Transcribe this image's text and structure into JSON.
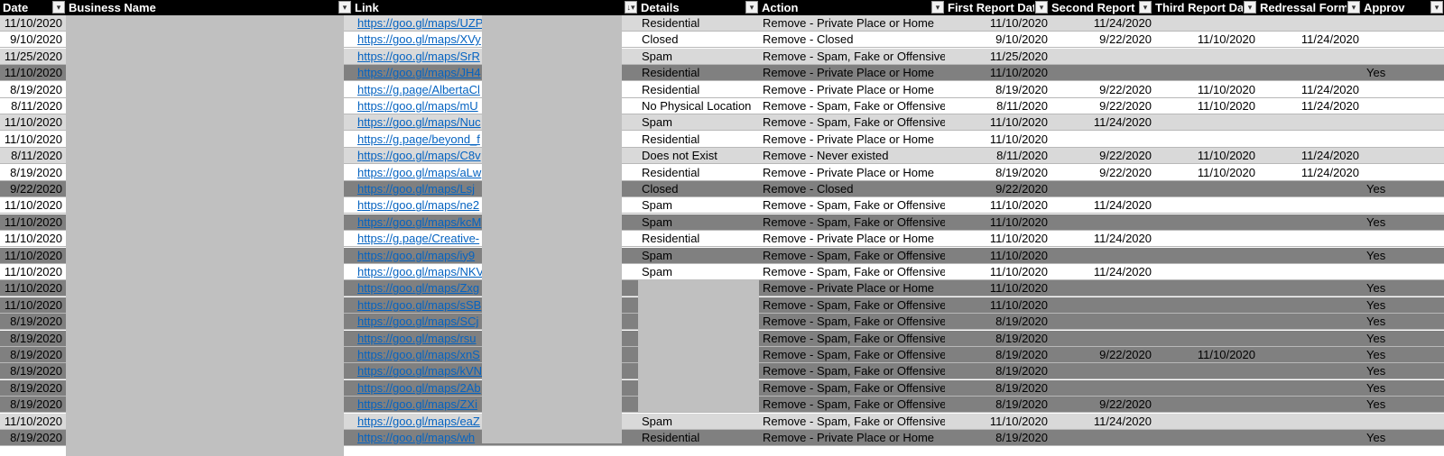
{
  "header": {
    "columns": [
      {
        "label": "Date",
        "filter": "▾"
      },
      {
        "label": "Business Name",
        "filter": "▾"
      },
      {
        "label": "Link",
        "filter": "↓▾"
      },
      {
        "label": "Details",
        "filter": "▾"
      },
      {
        "label": "Action",
        "filter": "▾"
      },
      {
        "label": "First Report Date",
        "filter": "▾"
      },
      {
        "label": "Second Report Da",
        "filter": "▾"
      },
      {
        "label": "Third Report Date",
        "filter": "▾"
      },
      {
        "label": "Redressal Form",
        "filter": "▾"
      },
      {
        "label": "Approv",
        "filter": "▾"
      }
    ]
  },
  "rows": [
    {
      "date": "11/10/2020",
      "link": "https://goo.gl/maps/UZP",
      "details": "Residential",
      "action": "Remove - Private Place or Home",
      "first": "11/10/2020",
      "second": "11/24/2020",
      "third": "",
      "form": "",
      "approved": "",
      "shade": "light"
    },
    {
      "date": "9/10/2020",
      "link": "https://goo.gl/maps/XVy",
      "details": "Closed",
      "action": "Remove - Closed",
      "first": "9/10/2020",
      "second": "9/22/2020",
      "third": "11/10/2020",
      "form": "11/24/2020",
      "approved": "",
      "shade": "white"
    },
    {
      "date": "11/25/2020",
      "link": "https://goo.gl/maps/SrR",
      "details": "Spam",
      "action": "Remove - Spam, Fake or Offensive",
      "first": "11/25/2020",
      "second": "",
      "third": "",
      "form": "",
      "approved": "",
      "shade": "light"
    },
    {
      "date": "11/10/2020",
      "link": "https://goo.gl/maps/JH4",
      "details": "Residential",
      "action": "Remove - Private Place or Home",
      "first": "11/10/2020",
      "second": "",
      "third": "",
      "form": "",
      "approved": "Yes",
      "shade": "dark"
    },
    {
      "date": "8/19/2020",
      "link": "https://g.page/AlbertaCl",
      "details": "Residential",
      "action": "Remove - Private Place or Home",
      "first": "8/19/2020",
      "second": "9/22/2020",
      "third": "11/10/2020",
      "form": "11/24/2020",
      "approved": "",
      "shade": "white"
    },
    {
      "date": "8/11/2020",
      "link": "https://goo.gl/maps/mU",
      "details": "No Physical Location",
      "action": "Remove - Spam, Fake or Offensive",
      "first": "8/11/2020",
      "second": "9/22/2020",
      "third": "11/10/2020",
      "form": "11/24/2020",
      "approved": "",
      "shade": "white"
    },
    {
      "date": "11/10/2020",
      "link": "https://goo.gl/maps/Nuc",
      "details": "Spam",
      "action": "Remove - Spam, Fake or Offensive",
      "first": "11/10/2020",
      "second": "11/24/2020",
      "third": "",
      "form": "",
      "approved": "",
      "shade": "light"
    },
    {
      "date": "11/10/2020",
      "link": "https://g.page/beyond_f",
      "details": "Residential",
      "action": "Remove - Private Place or Home",
      "first": "11/10/2020",
      "second": "",
      "third": "",
      "form": "",
      "approved": "",
      "shade": "white"
    },
    {
      "date": "8/11/2020",
      "link": "https://goo.gl/maps/C8v",
      "details": "Does not Exist",
      "action": "Remove - Never existed",
      "first": "8/11/2020",
      "second": "9/22/2020",
      "third": "11/10/2020",
      "form": "11/24/2020",
      "approved": "",
      "shade": "light"
    },
    {
      "date": "8/19/2020",
      "link": "https://goo.gl/maps/aLw",
      "details": "Residential",
      "action": "Remove - Private Place or Home",
      "first": "8/19/2020",
      "second": "9/22/2020",
      "third": "11/10/2020",
      "form": "11/24/2020",
      "approved": "",
      "shade": "white"
    },
    {
      "date": "9/22/2020",
      "link": "https://goo.gl/maps/Lsj",
      "details": "Closed",
      "action": "Remove - Closed",
      "first": "9/22/2020",
      "second": "",
      "third": "",
      "form": "",
      "approved": "Yes",
      "shade": "dark"
    },
    {
      "date": "11/10/2020",
      "link": "https://goo.gl/maps/ne2",
      "details": "Spam",
      "action": "Remove - Spam, Fake or Offensive",
      "first": "11/10/2020",
      "second": "11/24/2020",
      "third": "",
      "form": "",
      "approved": "",
      "shade": "white"
    },
    {
      "date": "11/10/2020",
      "link": "https://goo.gl/maps/kcM",
      "details": "Spam",
      "action": "Remove - Spam, Fake or Offensive",
      "first": "11/10/2020",
      "second": "",
      "third": "",
      "form": "",
      "approved": "Yes",
      "shade": "dark"
    },
    {
      "date": "11/10/2020",
      "link": "https://g.page/Creative-",
      "details": "Residential",
      "action": "Remove - Private Place or Home",
      "first": "11/10/2020",
      "second": "11/24/2020",
      "third": "",
      "form": "",
      "approved": "",
      "shade": "white"
    },
    {
      "date": "11/10/2020",
      "link": "https://goo.gl/maps/iy9",
      "details": "Spam",
      "action": "Remove - Spam, Fake or Offensive",
      "first": "11/10/2020",
      "second": "",
      "third": "",
      "form": "",
      "approved": "Yes",
      "shade": "dark"
    },
    {
      "date": "11/10/2020",
      "link": "https://goo.gl/maps/NKV",
      "details": "Spam",
      "action": "Remove - Spam, Fake or Offensive",
      "first": "11/10/2020",
      "second": "11/24/2020",
      "third": "",
      "form": "",
      "approved": "",
      "shade": "white"
    },
    {
      "date": "11/10/2020",
      "link": "https://goo.gl/maps/Zxg",
      "details": "",
      "action": "Remove - Private Place or Home",
      "first": "11/10/2020",
      "second": "",
      "third": "",
      "form": "",
      "approved": "Yes",
      "shade": "dark"
    },
    {
      "date": "11/10/2020",
      "link": "https://goo.gl/maps/sSB",
      "details": "",
      "action": "Remove - Spam, Fake or Offensive",
      "first": "11/10/2020",
      "second": "",
      "third": "",
      "form": "",
      "approved": "Yes",
      "shade": "dark"
    },
    {
      "date": "8/19/2020",
      "link": "https://goo.gl/maps/SCj",
      "details": "",
      "action": "Remove - Spam, Fake or Offensive",
      "first": "8/19/2020",
      "second": "",
      "third": "",
      "form": "",
      "approved": "Yes",
      "shade": "dark"
    },
    {
      "date": "8/19/2020",
      "link": "https://goo.gl/maps/rsu",
      "details": "",
      "action": "Remove - Spam, Fake or Offensive",
      "first": "8/19/2020",
      "second": "",
      "third": "",
      "form": "",
      "approved": "Yes",
      "shade": "dark"
    },
    {
      "date": "8/19/2020",
      "link": "https://goo.gl/maps/xnS",
      "details": "",
      "action": "Remove - Spam, Fake or Offensive",
      "first": "8/19/2020",
      "second": "9/22/2020",
      "third": "11/10/2020",
      "form": "",
      "approved": "Yes",
      "shade": "dark"
    },
    {
      "date": "8/19/2020",
      "link": "https://goo.gl/maps/kVN",
      "details": "",
      "action": "Remove - Spam, Fake or Offensive",
      "first": "8/19/2020",
      "second": "",
      "third": "",
      "form": "",
      "approved": "Yes",
      "shade": "dark"
    },
    {
      "date": "8/19/2020",
      "link": "https://goo.gl/maps/2Ab",
      "details": "",
      "action": "Remove - Spam, Fake or Offensive",
      "first": "8/19/2020",
      "second": "",
      "third": "",
      "form": "",
      "approved": "Yes",
      "shade": "dark"
    },
    {
      "date": "8/19/2020",
      "link": "https://goo.gl/maps/ZXi",
      "details": "",
      "action": "Remove - Spam, Fake or Offensive",
      "first": "8/19/2020",
      "second": "9/22/2020",
      "third": "",
      "form": "",
      "approved": "Yes",
      "shade": "dark"
    },
    {
      "date": "11/10/2020",
      "link": "https://goo.gl/maps/eaZ",
      "details": "Spam",
      "action": "Remove - Spam, Fake or Offensive",
      "first": "11/10/2020",
      "second": "11/24/2020",
      "third": "",
      "form": "",
      "approved": "",
      "shade": "light"
    },
    {
      "date": "8/19/2020",
      "link": "https://goo.gl/maps/wh",
      "details": "Residential",
      "action": "Remove - Private Place or Home",
      "first": "8/19/2020",
      "second": "",
      "third": "",
      "form": "",
      "approved": "Yes",
      "shade": "dark"
    }
  ],
  "colors": {
    "header_bg": "#000000",
    "header_text": "#ffffff",
    "row_white": "#ffffff",
    "row_light": "#d9d9d9",
    "row_dark": "#808080",
    "redaction": "#c0c0c0",
    "link": "#0563c1"
  }
}
